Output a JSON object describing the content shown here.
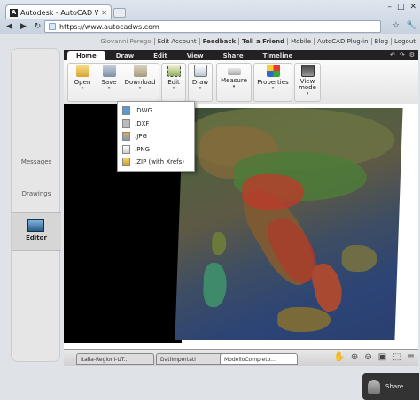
{
  "browser": {
    "tab_title": "Autodesk - AutoCAD WS",
    "tab_favicon": "A",
    "url_scheme": "https://",
    "url_host": "www.autocadws.com",
    "window_buttons": [
      "–",
      "□",
      "✕"
    ],
    "nav": [
      "◀",
      "▶",
      "↻",
      "⌂"
    ],
    "right_tools": [
      "☆",
      "🔧"
    ]
  },
  "topnav": {
    "user": "Giovanni Perego",
    "items": [
      "Edit Account",
      "Feedback",
      "Tell a Friend",
      "Mobile",
      "AutoCAD Plug-in",
      "Blog",
      "Logout"
    ]
  },
  "left_panel": {
    "items": [
      "Messages",
      "Drawings"
    ],
    "active": "Editor"
  },
  "ribbon": {
    "tabs": [
      "Home",
      "Draw",
      "Edit",
      "View",
      "Share",
      "Timeline"
    ],
    "active_tab": "Home",
    "buttons": [
      {
        "label": "Open",
        "icon": "folder-icon"
      },
      {
        "label": "Save",
        "icon": "disk-icon"
      },
      {
        "label": "Download",
        "icon": "download-icon"
      },
      {
        "label": "Edit",
        "icon": "edit-icon"
      },
      {
        "label": "Draw",
        "icon": "draw-icon"
      },
      {
        "label": "Measure",
        "icon": "ruler-icon"
      },
      {
        "label": "Properties",
        "icon": "properties-icon"
      },
      {
        "label": "View mode",
        "icon": "viewmode-icon"
      }
    ]
  },
  "download_menu": {
    "items": [
      ".DWG",
      ".DXF",
      ".JPG",
      ".PNG",
      ".ZIP (with Xrefs)"
    ]
  },
  "share_label": "Share",
  "doc_tabs": [
    "Italia-Regioni-UT...",
    "DatiImportati",
    "ModelloCompleto..."
  ],
  "colors": {
    "accent": "#1a8b1a",
    "ribbon_dark": "#222222"
  }
}
